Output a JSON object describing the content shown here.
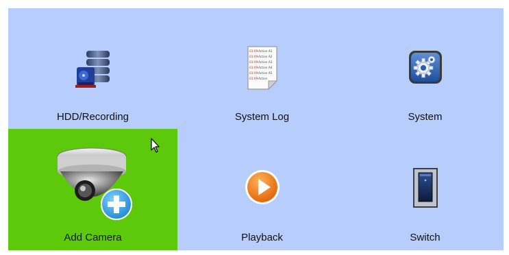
{
  "menu": {
    "items": [
      {
        "label": "HDD/Recording",
        "icon": "hdd-database-icon",
        "selected": false
      },
      {
        "label": "System Log",
        "icon": "system-log-document-icon",
        "selected": false
      },
      {
        "label": "System",
        "icon": "system-settings-gear-icon",
        "selected": false
      },
      {
        "label": "Add Camera",
        "icon": "dome-camera-add-icon",
        "selected": true
      },
      {
        "label": "Playback",
        "icon": "play-button-icon",
        "selected": false
      },
      {
        "label": "Switch",
        "icon": "power-switch-icon",
        "selected": false
      }
    ],
    "log_lines": [
      {
        "time": "01:09",
        "text": "Action A1"
      },
      {
        "time": "01:09",
        "text": "Action A2"
      },
      {
        "time": "01:09",
        "text": "Action A3"
      },
      {
        "time": "01:09",
        "text": "Action A4"
      },
      {
        "time": "01:09",
        "text": "Action A5"
      },
      {
        "time": "01:09",
        "text": "Action"
      }
    ]
  },
  "colors": {
    "background": "#b7cdfb",
    "selected_tile": "#5dc90b",
    "playback_orange": "#f47a16",
    "add_badge_blue": "#29a3e6"
  }
}
